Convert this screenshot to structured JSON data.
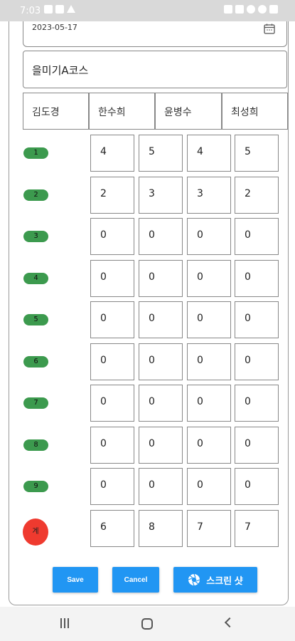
{
  "status_bar": {
    "time": "7:03",
    "left_icons": [
      "gallery-icon",
      "lock-icon",
      "warning-icon"
    ],
    "right_icons": [
      "alarm-icon",
      "mute-icon",
      "wifi-icon",
      "dnd-icon",
      "battery-icon"
    ]
  },
  "form": {
    "date": "2023-05-17",
    "course": "을미기A코스"
  },
  "players": [
    "김도경",
    "한수희",
    "윤병수",
    "최성희"
  ],
  "holes": [
    {
      "label": "1",
      "scores": [
        "4",
        "5",
        "4",
        "5"
      ]
    },
    {
      "label": "2",
      "scores": [
        "2",
        "3",
        "3",
        "2"
      ]
    },
    {
      "label": "3",
      "scores": [
        "0",
        "0",
        "0",
        "0"
      ]
    },
    {
      "label": "4",
      "scores": [
        "0",
        "0",
        "0",
        "0"
      ]
    },
    {
      "label": "5",
      "scores": [
        "0",
        "0",
        "0",
        "0"
      ]
    },
    {
      "label": "6",
      "scores": [
        "0",
        "0",
        "0",
        "0"
      ]
    },
    {
      "label": "7",
      "scores": [
        "0",
        "0",
        "0",
        "0"
      ]
    },
    {
      "label": "8",
      "scores": [
        "0",
        "0",
        "0",
        "0"
      ]
    },
    {
      "label": "9",
      "scores": [
        "0",
        "0",
        "0",
        "0"
      ]
    }
  ],
  "total": {
    "label": "계",
    "scores": [
      "6",
      "8",
      "7",
      "7"
    ]
  },
  "buttons": {
    "save": "Save",
    "cancel": "Cancel",
    "screenshot": "스크린 샷"
  },
  "colors": {
    "hole_badge": "#3c9a4e",
    "total_badge": "#ef3a2f",
    "button": "#2196f3"
  },
  "nav_icons": [
    "recent-apps-icon",
    "home-icon",
    "back-icon"
  ]
}
